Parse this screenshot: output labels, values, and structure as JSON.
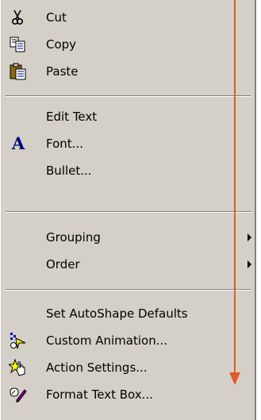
{
  "menu": {
    "sections": [
      {
        "items": [
          {
            "label": "Cut",
            "icon": "scissors-icon"
          },
          {
            "label": "Copy",
            "icon": "copy-icon"
          },
          {
            "label": "Paste",
            "icon": "paste-icon"
          }
        ]
      },
      {
        "items": [
          {
            "label": "Edit Text"
          },
          {
            "label": "Font...",
            "icon": "font-icon",
            "icon_glyph": "A"
          },
          {
            "label": "Bullet..."
          }
        ]
      },
      {
        "items": [
          {
            "label": "Grouping",
            "submenu": true
          },
          {
            "label": "Order",
            "submenu": true
          }
        ]
      },
      {
        "items": [
          {
            "label": "Set AutoShape Defaults"
          },
          {
            "label": "Custom Animation...",
            "icon": "custom-animation-icon"
          },
          {
            "label": "Action Settings...",
            "icon": "action-settings-icon"
          },
          {
            "label": "Format Text Box...",
            "icon": "format-text-box-icon"
          }
        ]
      }
    ]
  },
  "colors": {
    "menu_background": "#d4d0c8",
    "indicator_arrow": "#e05a2b"
  }
}
